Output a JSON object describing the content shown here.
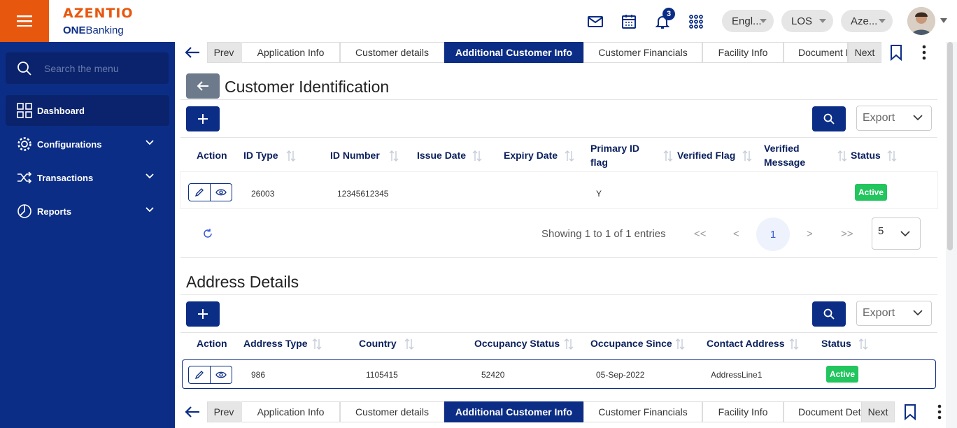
{
  "app": {
    "brand_top": "AZENTIO",
    "brand_bottom_bold": "ONE",
    "brand_bottom_rest": "Banking",
    "notif_count": "3"
  },
  "header": {
    "lang": "Engl...",
    "module": "LOS",
    "user": "Aze..."
  },
  "sidebar": {
    "search_placeholder": "Search the menu",
    "items": [
      {
        "label": "Dashboard",
        "icon": "grid-icon"
      },
      {
        "label": "Configurations",
        "icon": "gear-icon"
      },
      {
        "label": "Transactions",
        "icon": "shuffle-icon"
      },
      {
        "label": "Reports",
        "icon": "pie-chart-icon"
      }
    ]
  },
  "tabs": {
    "prev": "Prev",
    "next": "Next",
    "items": [
      "Application Info",
      "Customer details",
      "Additional Customer Info",
      "Customer Financials",
      "Facility Info",
      "Document Det"
    ]
  },
  "identification": {
    "title": "Customer Identification",
    "export": "Export",
    "columns": [
      "Action",
      "ID Type",
      "ID Number",
      "Issue Date",
      "Expiry Date",
      "Primary ID flag",
      "Verified Flag",
      "Verified Message",
      "Status"
    ],
    "row": {
      "id_type": "26003",
      "id_number": "12345612345",
      "issue_date": "",
      "expiry_date": "",
      "primary_flag": "Y",
      "verified_flag": "",
      "verified_message": "",
      "status": "Active"
    },
    "pager": {
      "showing": "Showing 1 to 1 of 1 entries",
      "first": "<<",
      "prev": "<",
      "page": "1",
      "next": ">",
      "last": ">>",
      "size": "5"
    }
  },
  "address": {
    "title": "Address Details",
    "export": "Export",
    "columns": [
      "Action",
      "Address Type",
      "Country",
      "Occupancy Status",
      "Occupance Since",
      "Contact Address",
      "Status"
    ],
    "row": {
      "address_type": "986",
      "country": "1105415",
      "occupancy_status": "52420",
      "since": "05-Sep-2022",
      "contact": "AddressLine1",
      "status": "Active"
    }
  },
  "colors": {
    "navy": "#0b2d85",
    "orange": "#e8570e",
    "active_green": "#22c55e"
  }
}
